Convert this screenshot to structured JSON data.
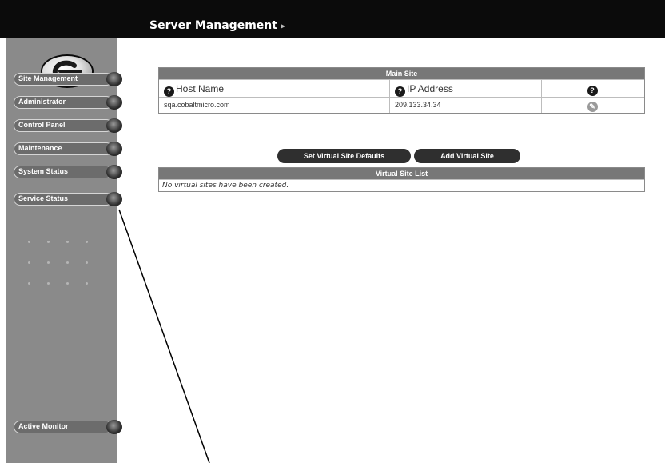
{
  "header": {
    "title": "Server Management",
    "title_arrow": "▸"
  },
  "sidebar": {
    "items": [
      {
        "label": "Site Management"
      },
      {
        "label": "Administrator"
      },
      {
        "label": "Control Panel"
      },
      {
        "label": "Maintenance"
      },
      {
        "label": "System Status"
      },
      {
        "label": "Service Status"
      }
    ],
    "bottom_item": {
      "label": "Active Monitor"
    }
  },
  "main_site": {
    "heading": "Main Site",
    "columns": [
      "Host Name",
      "IP Address",
      ""
    ],
    "row": {
      "host_name": "sqa.cobaltmicro.com",
      "ip_address": "209.133.34.34"
    }
  },
  "actions": {
    "set_defaults": "Set Virtual Site Defaults",
    "add_site": "Add Virtual Site"
  },
  "virtual_sites": {
    "heading": "Virtual Site List",
    "empty_message": "No virtual sites have been created."
  },
  "icons": {
    "help": "?",
    "logo": "cobalt-logo",
    "edit": "edit-icon"
  },
  "colors": {
    "topbar": "#0b0b0b",
    "sidebar": "#8a8a8a",
    "table_header": "#777777"
  }
}
